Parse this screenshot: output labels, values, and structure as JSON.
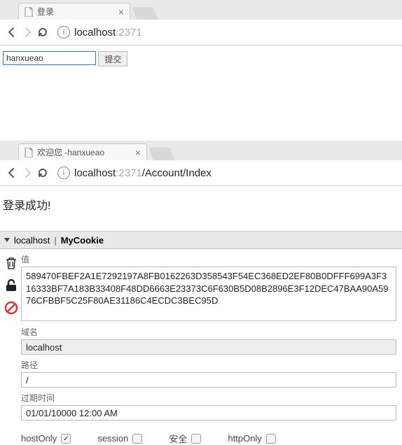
{
  "browser1": {
    "tab_title": "登录",
    "url_host": "localhost",
    "url_port": ":2371",
    "url_path": ""
  },
  "login_form": {
    "username_value": "hanxueao",
    "submit_label": "提交"
  },
  "browser2": {
    "tab_title": "欢迎您 -hanxueao",
    "url_host": "localhost",
    "url_port": ":2371",
    "url_path": "/Account/Index"
  },
  "page2": {
    "message": "登录成功!"
  },
  "devtools": {
    "crumb_host": "localhost",
    "crumb_cookie": "MyCookie",
    "value_label": "值",
    "value": "589470FBEF2A1E7292197A8FB0162263D358543F54EC368ED2EF80B0DFFF699A3F316333BF7A183B33408F48DD6663E23373C6F630B5D08B2896E3F12DEC47BAA90A5976CFBBF5C25F80AE31186C4ECDC3BEC95D",
    "domain_label": "域名",
    "domain_value": "localhost",
    "path_label": "路径",
    "path_value": "/",
    "expire_label": "过期时间",
    "expire_value": "01/01/10000 12:00 AM",
    "flags": {
      "hostOnly": {
        "label": "hostOnly",
        "checked": true
      },
      "session": {
        "label": "session",
        "checked": false
      },
      "secure": {
        "label": "安全",
        "checked": false
      },
      "httpOnly": {
        "label": "httpOnly",
        "checked": false
      }
    }
  }
}
